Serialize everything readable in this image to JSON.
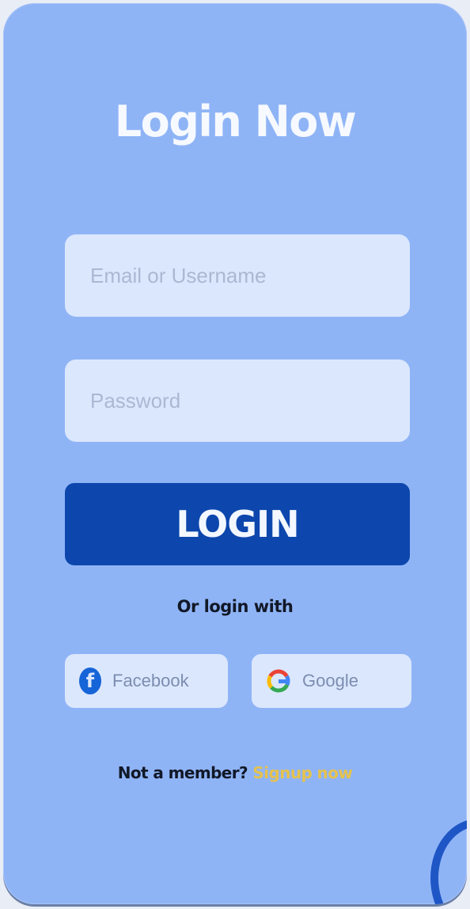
{
  "title": "Login Now",
  "form": {
    "email_placeholder": "Email or Username",
    "email_value": "",
    "password_placeholder": "Password",
    "password_value": "",
    "login_label": "LOGIN"
  },
  "social": {
    "divider_text": "Or login with",
    "facebook_label": "Facebook",
    "google_label": "Google"
  },
  "footer": {
    "prompt": "Not a member?",
    "signup_label": "Signup now"
  },
  "colors": {
    "card_bg": "#8fb4f6",
    "field_bg": "#dbe7fd",
    "primary": "#0d47ad",
    "link": "#e4c24e",
    "facebook_blue": "#1565d8"
  },
  "icons": {
    "facebook": "facebook-icon",
    "google": "google-icon"
  }
}
